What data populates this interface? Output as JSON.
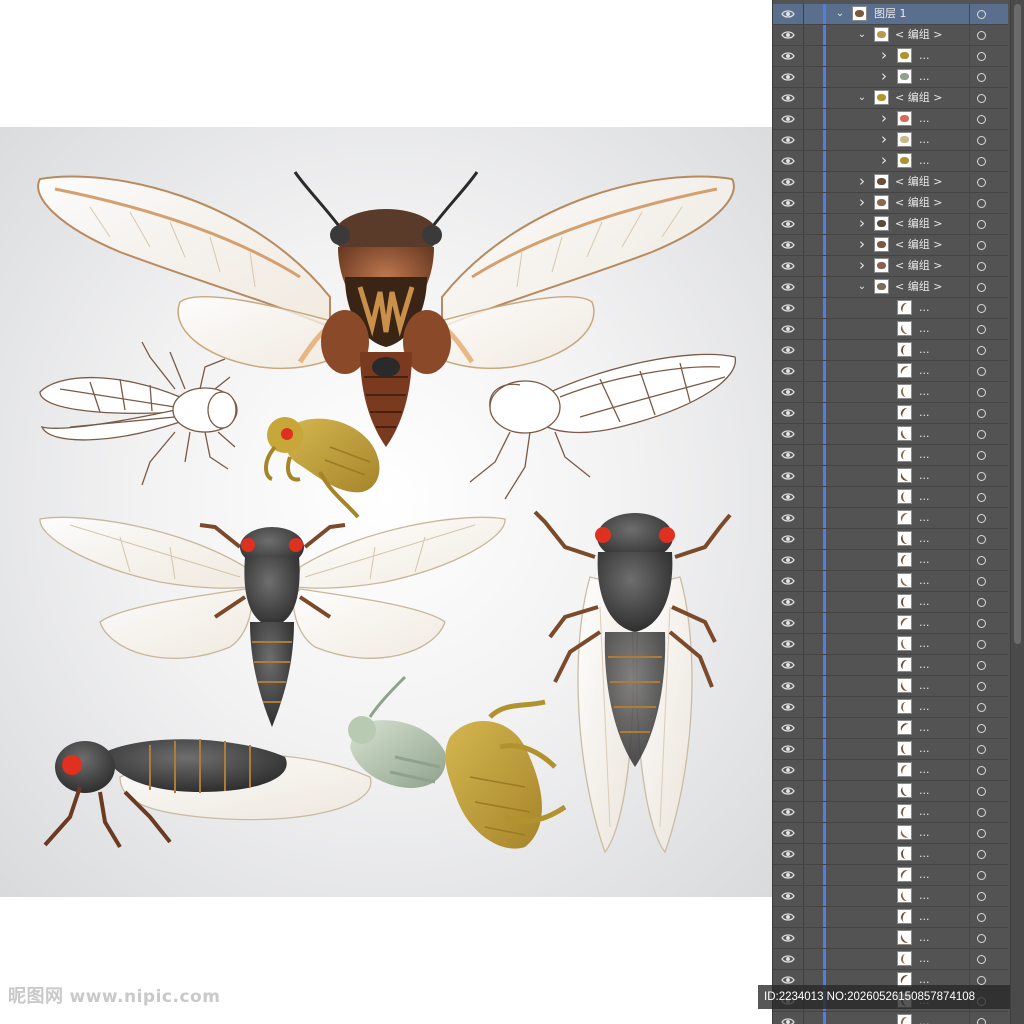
{
  "watermark": {
    "logo": "昵图网",
    "site": "www.nipic.com"
  },
  "id_bar": {
    "text": "ID:2234013 NO:20260526150857874108"
  },
  "layers_panel": {
    "top_layer": {
      "name": "图层",
      "index": "1"
    },
    "group_label": "< 编组 >",
    "ellipsis": "...",
    "rows": [
      {
        "depth": 0,
        "chevron": "down",
        "label_type": "layer",
        "thumb": "#7a5a3a",
        "selected": true
      },
      {
        "depth": 1,
        "chevron": "down",
        "label_type": "group",
        "thumb": "#b99a4a"
      },
      {
        "depth": 2,
        "chevron": "right",
        "label_type": "ellipsis",
        "thumb": "#b0932e"
      },
      {
        "depth": 2,
        "chevron": "right",
        "label_type": "ellipsis",
        "thumb": "#8fa08f"
      },
      {
        "depth": 1,
        "chevron": "down",
        "label_type": "group",
        "thumb": "#b0932e"
      },
      {
        "depth": 2,
        "chevron": "right",
        "label_type": "ellipsis",
        "thumb": "#d66b5a"
      },
      {
        "depth": 2,
        "chevron": "right",
        "label_type": "ellipsis",
        "thumb": "#c9b88a"
      },
      {
        "depth": 2,
        "chevron": "right",
        "label_type": "ellipsis",
        "thumb": "#b0932e"
      },
      {
        "depth": 1,
        "chevron": "right",
        "label_type": "group",
        "thumb": "#6a4e3a"
      },
      {
        "depth": 1,
        "chevron": "right",
        "label_type": "group",
        "thumb": "#8a6a4a"
      },
      {
        "depth": 1,
        "chevron": "right",
        "label_type": "group",
        "thumb": "#5a4a3a"
      },
      {
        "depth": 1,
        "chevron": "right",
        "label_type": "group",
        "thumb": "#7a5a40"
      },
      {
        "depth": 1,
        "chevron": "right",
        "label_type": "group",
        "thumb": "#8a6050"
      },
      {
        "depth": 1,
        "chevron": "down",
        "label_type": "group",
        "thumb": "#7a6a5a"
      }
    ],
    "leaf_count": 35
  },
  "colors": {
    "panel_bg": "#535353",
    "selected_row": "#5a6f8e",
    "blue_bar": "#4f7ee8",
    "brown_cicada": "#7a4a30",
    "dark_cicada": "#4a4a4a",
    "red_eye": "#e03020",
    "golden_shell": "#b8982e",
    "pale_shell": "#b8c8b0"
  }
}
